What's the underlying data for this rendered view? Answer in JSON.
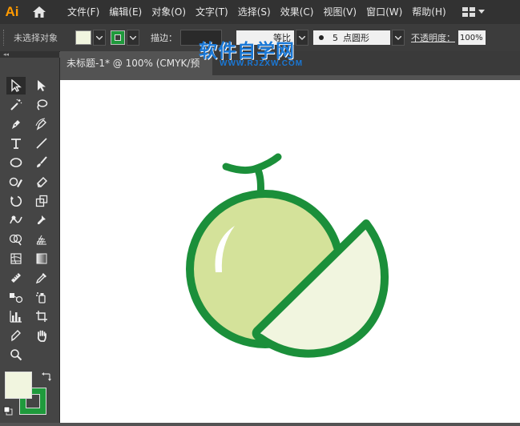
{
  "app": {
    "logo": "Ai"
  },
  "menu": [
    "文件(F)",
    "编辑(E)",
    "对象(O)",
    "文字(T)",
    "选择(S)",
    "效果(C)",
    "视图(V)",
    "窗口(W)",
    "帮助(H)"
  ],
  "control": {
    "selection": "未选择对象",
    "stroke_label": "描边：",
    "ratio_label": "等比",
    "brush_size": "5",
    "brush_name": "点圆形",
    "opacity_label": "不透明度：",
    "opacity_value": "100%"
  },
  "document": {
    "tab_title": "未标题-1* @ 100% (CMYK/预"
  },
  "watermark": {
    "main": "软件自学网",
    "sub": "WWW.RJZXW.COM"
  },
  "colors": {
    "fill": "#f1f5df",
    "stroke": "#1f9a3c",
    "melon_body": "#d4e29a",
    "melon_slice": "#f1f5df",
    "accent": "#ff9a00"
  },
  "icons": {
    "home": "home-icon",
    "workspace": "workspace-grid-icon",
    "swap": "swap-colors-icon"
  }
}
